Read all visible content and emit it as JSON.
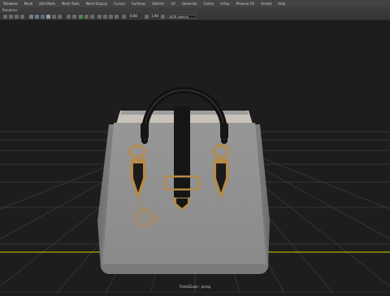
{
  "menubar": {
    "items": [
      "Windows",
      "Mesh",
      "Edit Mesh",
      "Mesh Tools",
      "Mesh Display",
      "Curves",
      "Surfaces",
      "Deform",
      "UV",
      "Generate",
      "Cache",
      "V-Ray",
      "Phoenix FD",
      "Arnold",
      "Help"
    ]
  },
  "panel_menu": {
    "label": "Renderer"
  },
  "toolbar": {
    "value_a": "0.00",
    "value_b": "1.00",
    "colorspace": "sRGB gamma"
  },
  "viewport": {
    "camera_label": "Front/Zoom : persp"
  },
  "colors": {
    "background": "#1d1d1d",
    "grid_line": "#3a3a3a",
    "axis_line": "#d8d000",
    "bag_body": "#8c8c8c",
    "leather": "#1b1b1b",
    "gold_hardware": "#b58b4a"
  },
  "icons": [
    "select-icon",
    "move-icon",
    "rotate-icon",
    "scale-icon",
    "camera-icon",
    "grid-icon",
    "wireframe-icon",
    "shaded-icon",
    "light-icon",
    "shadow-icon",
    "render-icon",
    "hud-icon"
  ]
}
